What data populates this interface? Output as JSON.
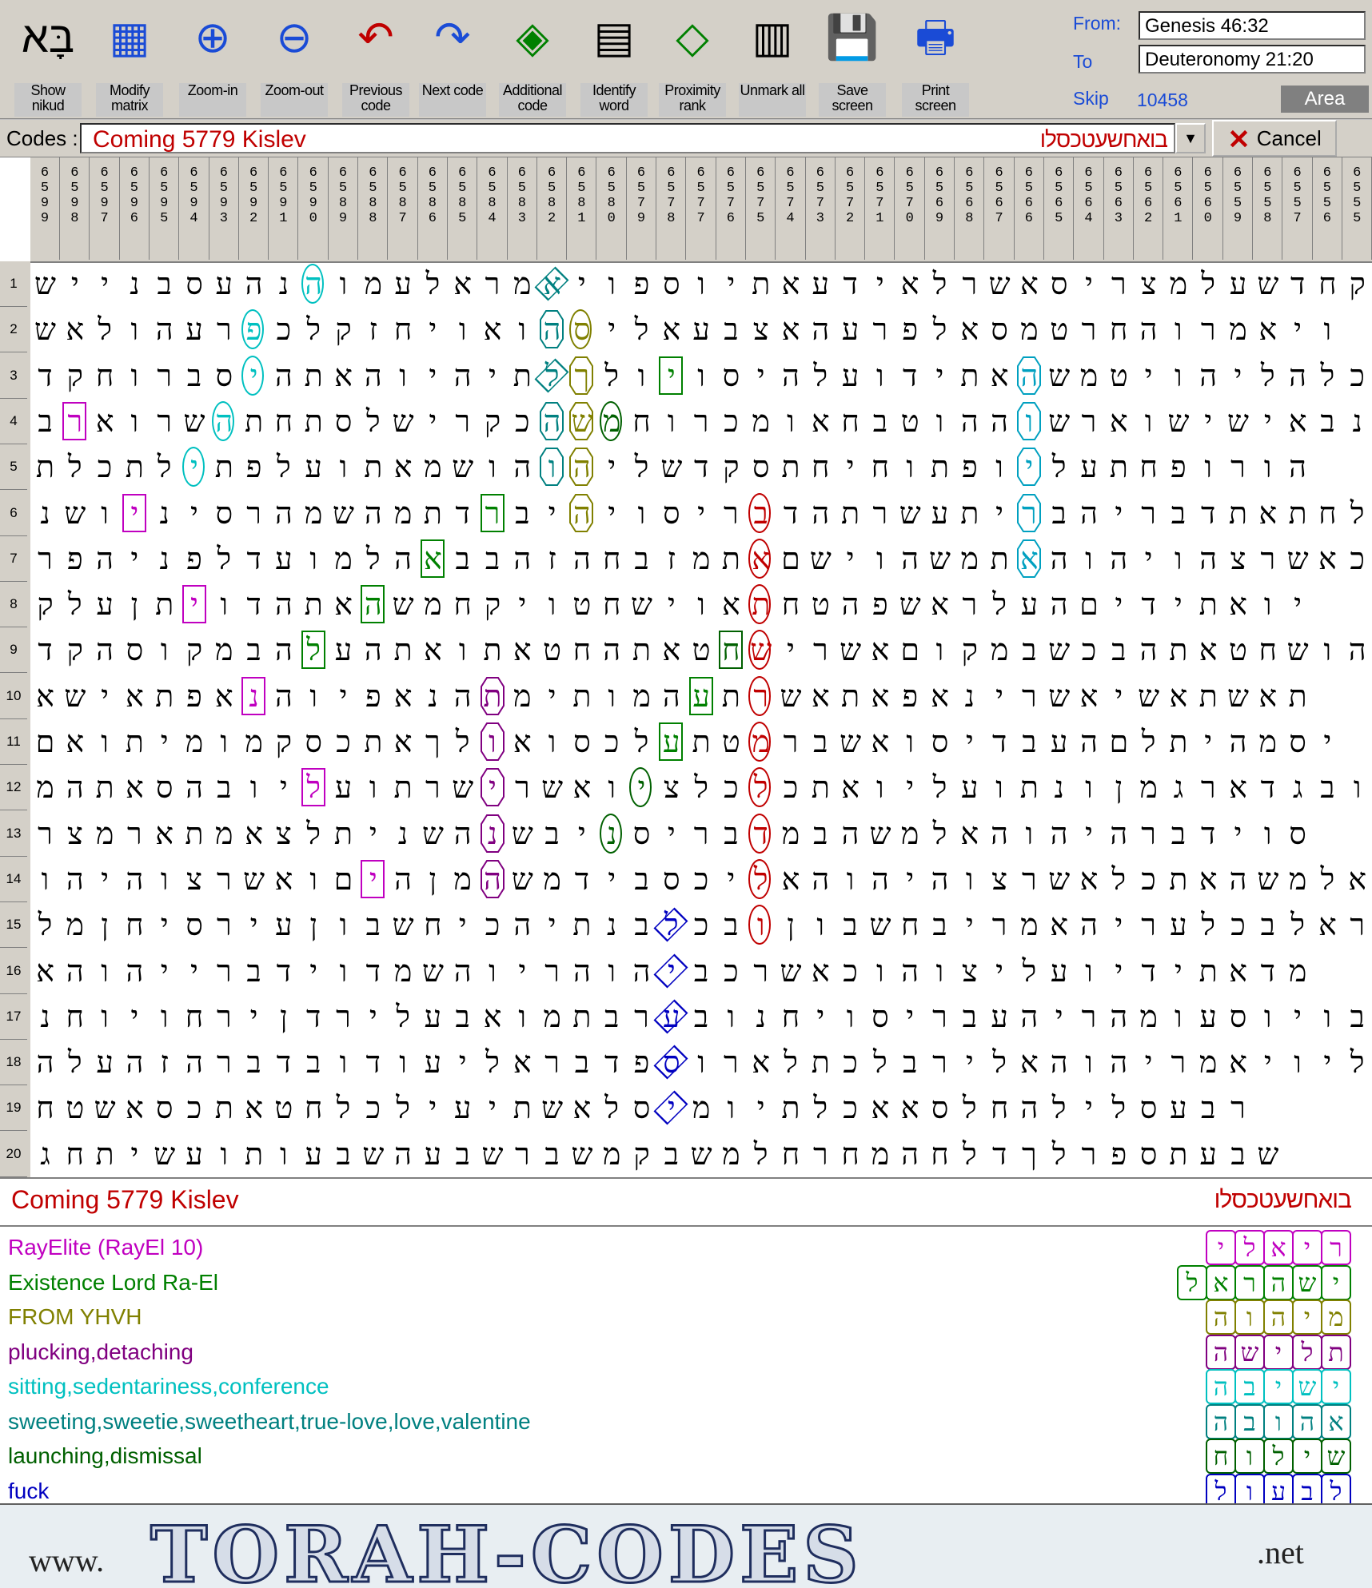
{
  "toolbar": {
    "buttons": [
      {
        "id": "show-nikud",
        "label": "Show nikud",
        "icon": "bet-aleph-nikud-icon"
      },
      {
        "id": "modify-matrix",
        "label": "Modify matrix",
        "icon": "matrix-grid-icon"
      },
      {
        "id": "zoom-in",
        "label": "Zoom-in",
        "icon": "zoom-in-magnifier-icon"
      },
      {
        "id": "zoom-out",
        "label": "Zoom-out",
        "icon": "zoom-out-magnifier-icon"
      },
      {
        "id": "previous-code",
        "label": "Previous code",
        "icon": "previous-arrow-letters-icon"
      },
      {
        "id": "next-code",
        "label": "Next code",
        "icon": "next-arrow-letters-icon"
      },
      {
        "id": "additional-code",
        "label": "Additional code",
        "icon": "additional-code-icon"
      },
      {
        "id": "identify-word",
        "label": "Identify word",
        "icon": "identify-word-icon"
      },
      {
        "id": "proximity-rank",
        "label": "Proximity rank",
        "icon": "proximity-rank-icon"
      },
      {
        "id": "unmark-all",
        "label": "Unmark all",
        "icon": "unmark-all-icon"
      },
      {
        "id": "save-screen",
        "label": "Save screen",
        "icon": "save-floppy-icon"
      },
      {
        "id": "print-screen",
        "label": "Print screen",
        "icon": "printer-icon"
      }
    ],
    "from_label": "From:",
    "from_value": "Genesis 46:32",
    "to_label": "To",
    "to_value": "Deuteronomy 21:20",
    "skip_label": "Skip",
    "skip_value": "10458",
    "area_label": "Area"
  },
  "codes": {
    "label": "Codes :",
    "term": "Coming 5779 Kislev",
    "sequence": "בואחשעטכסלו",
    "cancel_label": "Cancel"
  },
  "columns": [
    "6599",
    "6598",
    "6597",
    "6596",
    "6595",
    "6594",
    "6593",
    "6592",
    "6591",
    "6590",
    "6589",
    "6588",
    "6587",
    "6586",
    "6585",
    "6584",
    "6583",
    "6582",
    "6581",
    "6580",
    "6579",
    "6578",
    "6577",
    "6576",
    "6575",
    "6574",
    "6573",
    "6572",
    "6571",
    "6570",
    "6569",
    "6568",
    "6567",
    "6566",
    "6565",
    "6564",
    "6563",
    "6562",
    "6561",
    "6560",
    "6559",
    "6558",
    "6557",
    "6556",
    "6555"
  ],
  "rows": [
    "שיינבסעהנהומעלארמאיופסויתאעדיאלרשאסירצמלעשדחק",
    "שאלוהערפכלקזחיואוהסילאעבצאהערפלאסמטרחהורמאיו",
    "דקחורבסיהתאהויהיתלךלויוסיהלעודיתאהשמטיוהילהלכהז",
    "בראורשהתחתסלשיר​קכהשמחורכמואחבטוההושראושישיאבנ",
    "תלכתליתפלעותאמשוהוהילשדקסתחיחותפויל​עתחפורוה",
    "נשויניסרהמשהמתדרביהיוסירבדהתרשעתירבהירבדתאתחל",
    "רפהינפלדעומלהאבבהזהחבזמתאםשיוהשמתאהוהיוהצרשאכ",
    "קלעןתיודהתאהשמחקיוטחשיואתחטהפשארלעהםידיתאוי",
    "דקהסוקמבהלעהתאותאטחהתאטחשירשאםוקמבשכבהתאטחשוה",
    "אשיאתפאנהויפאנהתמיתומהעתרשאתאפאנירשאישאתשאת",
    "םאותימומקסכתאךלואוסכלעתטמרבשאוסידבעהםלתיהמסי",
    "מהתאסהבוילעותרשירשאויצלכלכתאוילעותנוןמגראדגבו",
    "רצמראתמאצלתינשהנשבינסירבדמבהשמלאהוהיהרבדיוס",
    "והיהוצרשאוםיהןמהשמדיבסכילאהוהיהוצרשאלכתאהשמלא",
    "למןחיסריעןובשחיכהיתנבלכבוןובשחבירמאהירעלכבלאר",
    "אהוהיירבדיודמשהוירהוהיבכרשאכוהוצילעוידיתאדמ",
    "נחויוחריןדריל​עבאומתבר​עבונחיוסירבעהירהמוע​סויוב",
    "הלעהזהרבדבודועילארבדפסוראלתכלברילאהוהירמאיוילאע",
    "חטשאסכתאטחלכליעיתשאלסימויתלכאאסלחהלילסעבר",
    "גחתישעותועבשהעבשרבשמקבשמלחרחמהחלדךלרפסתעבש"
  ],
  "summary": {
    "term": "Coming 5779 Kislev",
    "sequence": "בואחשעטכסלו",
    "words": [
      {
        "text": "RayElite (RayEl 10)",
        "color": "#c000c0",
        "letters": "ריאלי"
      },
      {
        "text": "Existence Lord Ra-El",
        "color": "#008000",
        "letters": "ישהראל"
      },
      {
        "text": "FROM YHVH",
        "color": "#808000",
        "letters": "מיהוה"
      },
      {
        "text": "plucking,detaching",
        "color": "#800080",
        "letters": "תלישה"
      },
      {
        "text": "sitting,sedentariness,conference",
        "color": "#00c0c0",
        "letters": "ישיבה"
      },
      {
        "text": "sweeting,sweetie,sweetheart,true-love,love,valentine",
        "color": "#008080",
        "letters": "אהובה"
      },
      {
        "text": "launching,dismissal",
        "color": "#006000",
        "letters": "שילוח"
      },
      {
        "text": "fuck",
        "color": "#0000c0",
        "letters": "לבעול"
      }
    ]
  },
  "banner": {
    "prefix": "www.",
    "title": "TORAH-CODES",
    "suffix": ".net"
  }
}
